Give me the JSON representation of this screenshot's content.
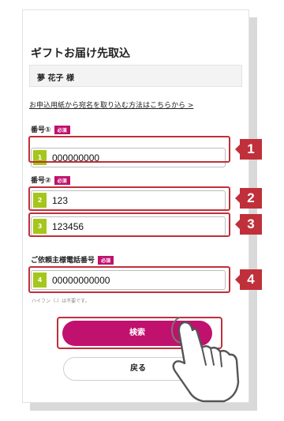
{
  "form": {
    "title": "ギフトお届け先取込",
    "recipient_name": "夢 花子 様",
    "help_link": "お申込用紙から宛名を取り込む方法はこちらから >",
    "required_badge": "必須",
    "fields": [
      {
        "label": "番号①",
        "step": "1",
        "value": "000000000",
        "marker": "1"
      },
      {
        "label": "番号②",
        "step": "2",
        "value": "123",
        "marker": "2"
      },
      {
        "label": "",
        "step": "3",
        "value": "123456",
        "marker": "3"
      },
      {
        "label": "ご依頼主様電話番号",
        "step": "4",
        "value": "00000000000",
        "marker": "4"
      }
    ],
    "phone_hint": "ハイフン（-）は不要です。",
    "search_label": "検索",
    "back_label": "戻る"
  },
  "colors": {
    "accent": "#c0116e",
    "step_badge": "#a5c61b",
    "annotation": "#c0303a"
  }
}
